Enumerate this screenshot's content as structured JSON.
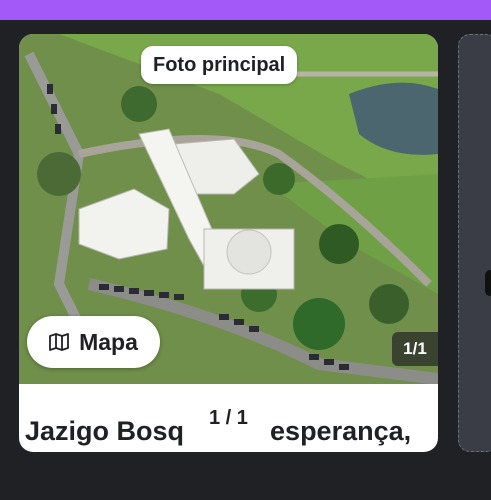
{
  "header": {
    "accent_color": "#a259f7"
  },
  "card": {
    "photo_label": "Foto principal",
    "map_button_label": "Mapa",
    "map_icon": "map-icon",
    "photo_counter": "1/1",
    "page_indicator": "1 / 1",
    "title_start": "Jazigo Bosq",
    "title_end": "esperança,"
  }
}
